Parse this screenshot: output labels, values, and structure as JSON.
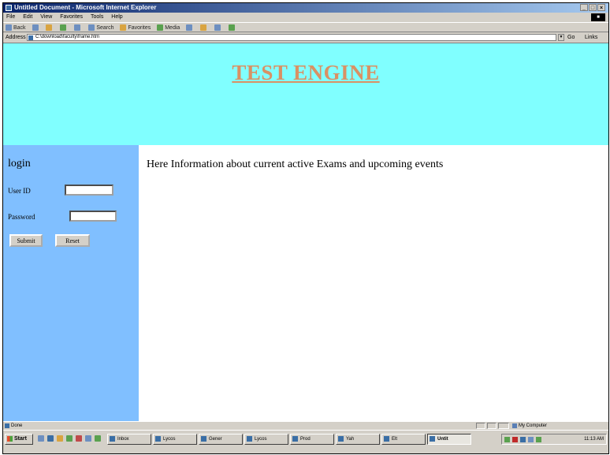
{
  "window": {
    "title": "Untitled Document - Microsoft Internet Explorer",
    "controls": [
      "_",
      "□",
      "×"
    ]
  },
  "menubar": {
    "items": [
      "File",
      "Edit",
      "View",
      "Favorites",
      "Tools",
      "Help"
    ]
  },
  "toolbar": {
    "back": "Back",
    "search": "Search",
    "favorites": "Favorites",
    "media": "Media"
  },
  "addressbar": {
    "label": "Address",
    "value": "C:\\download\\faculty\\frame.htm",
    "go": "Go",
    "links": "Links"
  },
  "page": {
    "header_title": "TEST ENGINE",
    "login_heading": "login",
    "user_id_label": "User ID",
    "password_label": "Password",
    "user_id_value": "",
    "password_value": "",
    "submit_label": "Submit",
    "reset_label": "Reset",
    "info_text": "Here Information about current active Exams and upcoming events",
    "colors": {
      "header_bg": "#80ffff",
      "sidebar_bg": "#80bfff",
      "title_color": "#d99164"
    }
  },
  "statusbar": {
    "status": "Done",
    "zone": "My Computer"
  },
  "taskbar": {
    "start": "Start",
    "tasks": [
      "Inbox",
      "Lycos",
      "Gener",
      "Lycos",
      "Prod",
      "Yah",
      "Elt",
      "Untit"
    ],
    "clock": "11:13 AM"
  }
}
